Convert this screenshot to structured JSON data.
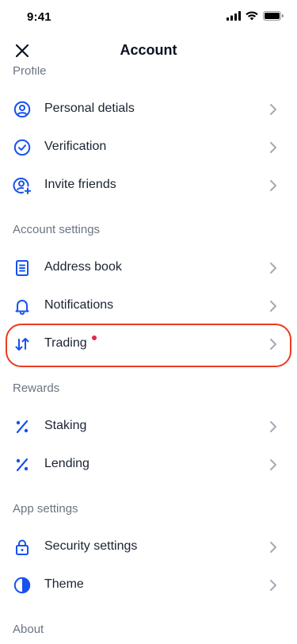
{
  "status": {
    "time": "9:41"
  },
  "header": {
    "title": "Account"
  },
  "sections": {
    "profile": "Profile",
    "account_settings": "Account settings",
    "rewards": "Rewards",
    "app_settings": "App settings",
    "about": "About"
  },
  "items": {
    "personal_details": "Personal detials",
    "verification": "Verification",
    "invite_friends": "Invite friends",
    "address_book": "Address book",
    "notifications": "Notifications",
    "trading": "Trading",
    "staking": "Staking",
    "lending": "Lending",
    "security_settings": "Security settings",
    "theme": "Theme"
  },
  "colors": {
    "accent": "#1652f0",
    "badge": "#e8254a",
    "highlight": "#ec3a1f",
    "section_text": "#6b7584"
  }
}
